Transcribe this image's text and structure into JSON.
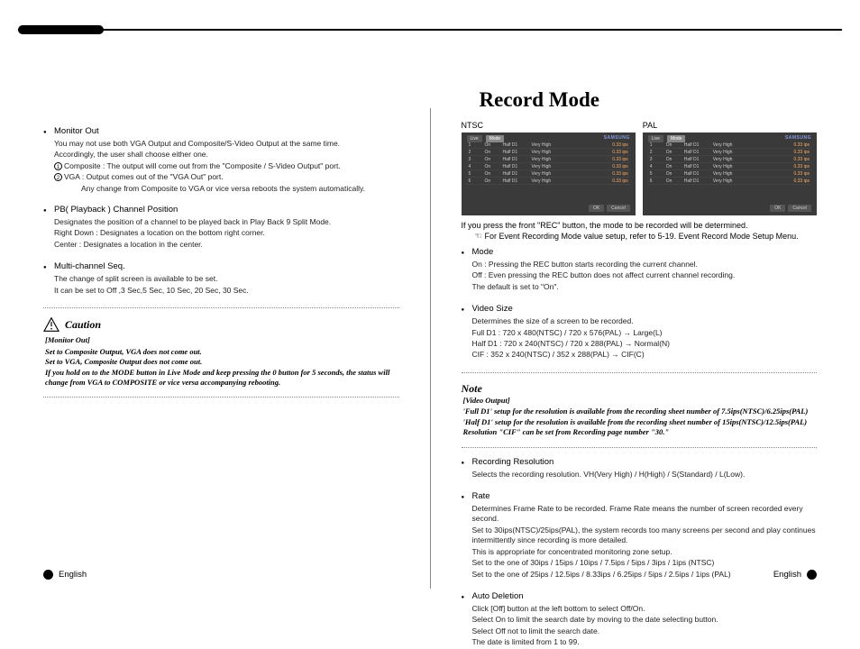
{
  "title": "Record Mode",
  "left": {
    "monitor_out": {
      "head": "Monitor Out",
      "s1": "You may not use both VGA Output and Composite/S-Video Output at the same time.",
      "s2": "Accordingly, the user shall choose either one.",
      "c1": "Composite : The output will come out from the \"Composite / S-Video Output\" port.",
      "c2": "VGA : Output comes out of the \"VGA Out\" port.",
      "c2b": "Any change from Composite to VGA or vice versa reboots the system automatically."
    },
    "pb": {
      "head": "PB( Playback ) Channel Position",
      "s1": "Designates the position of a channel to be played back in Play Back 9 Split Mode.",
      "s2": "Right Down : Designates a location on the bottom right corner.",
      "s3": "Center : Designates a location in the center."
    },
    "mc": {
      "head": "Multi-channel Seq.",
      "s1": "The change of split screen is available to be set.",
      "s2": "It can be set to Off ,3 Sec,5 Sec, 10 Sec, 20 Sec, 30 Sec."
    },
    "caution": {
      "title": "Caution",
      "head": "[Monitor Out]",
      "l1": "Set to Composite Output, VGA does not come out.",
      "l2": "Set to VGA, Composite Output does not come out.",
      "l3": "If you hold on to the MODE button in Live Mode and keep pressing the 0 button for 5 seconds, the status will change from VGA to COMPOSITE or vice versa accompanying rebooting."
    }
  },
  "right": {
    "shot_ntsc": "NTSC",
    "shot_pal": "PAL",
    "intro1": "If you press the front \"REC\" button, the mode to be recorded will be determined.",
    "intro2": "For Event Recording Mode value setup, refer to 5-19. Event Record Mode Setup Menu.",
    "mode": {
      "head": "Mode",
      "s1": "On : Pressing the REC button starts recording the current channel.",
      "s2": "Off : Even pressing the REC button does not affect current channel recording.",
      "s3": "The default is set to \"On\"."
    },
    "vsize": {
      "head": "Video Size",
      "s1": "Determines the size of a screen to be recorded.",
      "s2": "Full D1 : 720 x 480(NTSC) / 720 x 576(PAL) → Large(L)",
      "s3": "Half D1 : 720 x 240(NTSC) / 720 x 288(PAL) → Normal(N)",
      "s4": "CIF : 352 x 240(NTSC) / 352 x 288(PAL) → CIF(C)"
    },
    "note": {
      "title": "Note",
      "head": "[Video Output]",
      "l1": "'Full D1' setup for the resolution is available from the recording sheet number of 7.5ips(NTSC)/6.25ips(PAL)",
      "l2": "'Half D1' setup for the resolution is available from the recording sheet number of 15ips(NTSC)/12.5ips(PAL)",
      "l3": "Resolution \"CIF\" can be set from Recording page number \"30.\""
    },
    "recres": {
      "head": "Recording Resolution",
      "s1": "Selects the recording resolution. VH(Very High) / H(High) / S(Standard) / L(Low)."
    },
    "rate": {
      "head": "Rate",
      "s1": "Determines Frame Rate to be recorded. Frame Rate means the number of screen recorded every second.",
      "s2": "Set to 30ips(NTSC)/25ips(PAL), the system records too many screens per second and play continues intermittently since recording is more detailed.",
      "s3": "This is appropriate for concentrated monitoring zone setup.",
      "s4": "Set to the one of 30ips / 15ips / 10ips / 7.5ips / 5ips / 3ips / 1ips (NTSC)",
      "s5": "Set to the one of 25ips / 12.5ips / 8.33ips / 6.25ips / 5ips / 2.5ips / 1ips (PAL)"
    },
    "auto": {
      "head": "Auto Deletion",
      "s1": "Click [Off] button at the left bottom to select Off/On.",
      "s2": "Select On to limit the search date by moving to the date selecting button.",
      "s3": "Select Off not to limit the search date.",
      "s4": "The date is limited from 1 to 99."
    }
  },
  "footer": {
    "lang": "English"
  },
  "shot_rows": [
    {
      "ch": "1",
      "mode": "On",
      "size": "Half D1",
      "q": "Very High",
      "ips": "0.33 ips"
    },
    {
      "ch": "2",
      "mode": "On",
      "size": "Half D1",
      "q": "Very High",
      "ips": "0.33 ips"
    },
    {
      "ch": "3",
      "mode": "On",
      "size": "Half D1",
      "q": "Very High",
      "ips": "0.33 ips"
    },
    {
      "ch": "4",
      "mode": "On",
      "size": "Half D1",
      "q": "Very High",
      "ips": "0.33 ips"
    },
    {
      "ch": "5",
      "mode": "On",
      "size": "Half D1",
      "q": "Very High",
      "ips": "0.33 ips"
    },
    {
      "ch": "6",
      "mode": "On",
      "size": "Half D1",
      "q": "Very High",
      "ips": "0.33 ips"
    }
  ],
  "shot_tabs": {
    "a": "Live",
    "b": "Mode"
  },
  "shot_brand": "SAMSUNG",
  "shot_btn_ok": "OK",
  "shot_btn_cancel": "Cancel"
}
